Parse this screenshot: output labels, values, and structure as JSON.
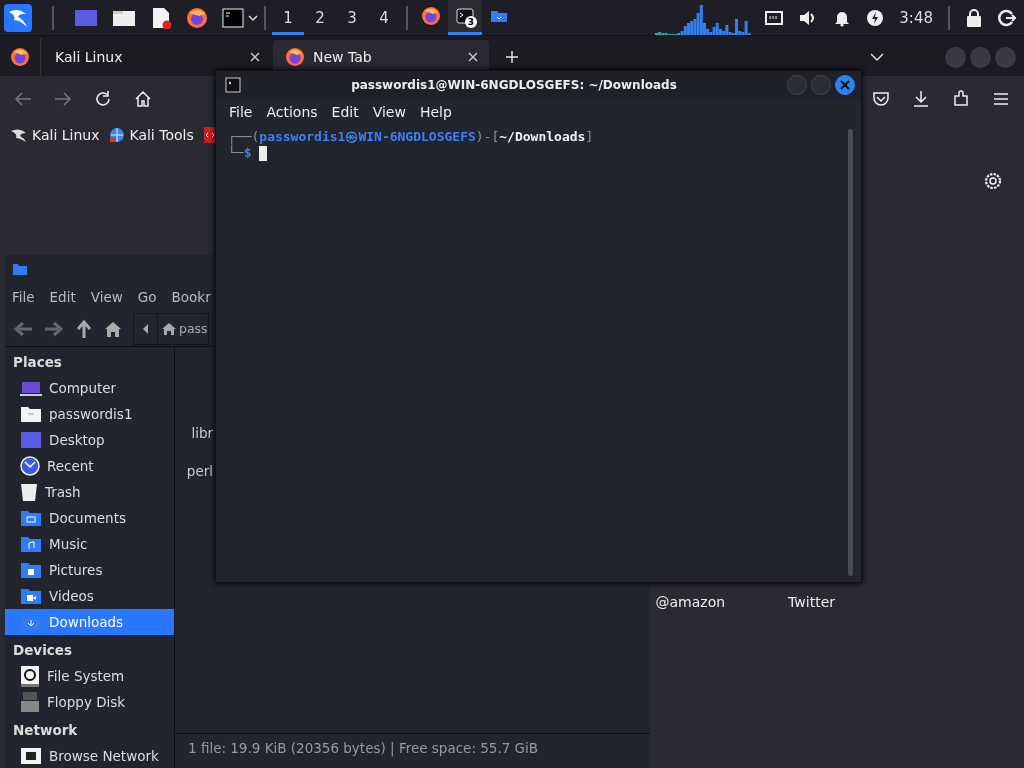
{
  "panel": {
    "workspaces": [
      {
        "label": "1",
        "selected": true
      },
      {
        "label": "2",
        "selected": false
      },
      {
        "label": "3",
        "selected": false
      },
      {
        "label": "4",
        "selected": false
      }
    ],
    "tasks": [
      {
        "kind": "browser",
        "selected": false
      },
      {
        "kind": "terminal",
        "selected": true,
        "badge": "3"
      },
      {
        "kind": "files",
        "selected": false
      }
    ],
    "clock": "3:48"
  },
  "browser": {
    "tabs": [
      {
        "label": "Kali Linux",
        "selected": false
      },
      {
        "label": "New Tab",
        "selected": true
      }
    ],
    "bookmarks": [
      {
        "kind": "kali",
        "label": "Kali Linux"
      },
      {
        "kind": "tools",
        "label": "Kali Tools"
      },
      {
        "kind": "exploit"
      }
    ],
    "shortcuts": [
      {
        "label": "@amazon"
      },
      {
        "label": "Twitter"
      }
    ]
  },
  "file_manager": {
    "menu": [
      "File",
      "Edit",
      "View",
      "Go",
      "Bookr"
    ],
    "path": "pass",
    "sidebar": [
      {
        "heading": "Places",
        "items": [
          {
            "kind": "computer",
            "label": "Computer",
            "selected": false
          },
          {
            "kind": "home",
            "label": "passwordis1",
            "selected": false
          },
          {
            "kind": "desktop",
            "label": "Desktop",
            "selected": false
          },
          {
            "kind": "recent",
            "label": "Recent",
            "selected": false
          },
          {
            "kind": "trash",
            "label": "Trash",
            "selected": false
          },
          {
            "kind": "documents",
            "label": "Documents",
            "selected": false
          },
          {
            "kind": "music",
            "label": "Music",
            "selected": false
          },
          {
            "kind": "pictures",
            "label": "Pictures",
            "selected": false
          },
          {
            "kind": "videos",
            "label": "Videos",
            "selected": false
          },
          {
            "kind": "downloads",
            "label": "Downloads",
            "selected": true
          }
        ]
      },
      {
        "heading": "Devices",
        "items": [
          {
            "kind": "drive",
            "label": "File System",
            "selected": false
          },
          {
            "kind": "floppy",
            "label": "Floppy Disk",
            "selected": false
          }
        ]
      },
      {
        "heading": "Network",
        "items": [
          {
            "kind": "network",
            "label": "Browse Network",
            "selected": false
          }
        ]
      }
    ],
    "files": [
      "libr",
      "perl"
    ],
    "status": "1 file: 19.9 KiB (20356 bytes) | Free space: 55.7 GiB"
  },
  "terminal": {
    "title": "passwordis1@WIN-6NGDLOSGEFS: ~/Downloads",
    "menu": [
      "File",
      "Actions",
      "Edit",
      "View",
      "Help"
    ],
    "lines": [
      [
        {
          "kind": "frame",
          "text": "┌──("
        },
        {
          "kind": "user",
          "text": "passwordis1㉿WIN-6NGDLOSGEFS"
        },
        {
          "kind": "frame",
          "text": ")-["
        },
        {
          "kind": "path",
          "text": "~/Downloads"
        },
        {
          "kind": "frame",
          "text": "]"
        }
      ],
      [
        {
          "kind": "frame",
          "text": "└─"
        },
        {
          "kind": "user",
          "text": "$"
        }
      ]
    ]
  }
}
